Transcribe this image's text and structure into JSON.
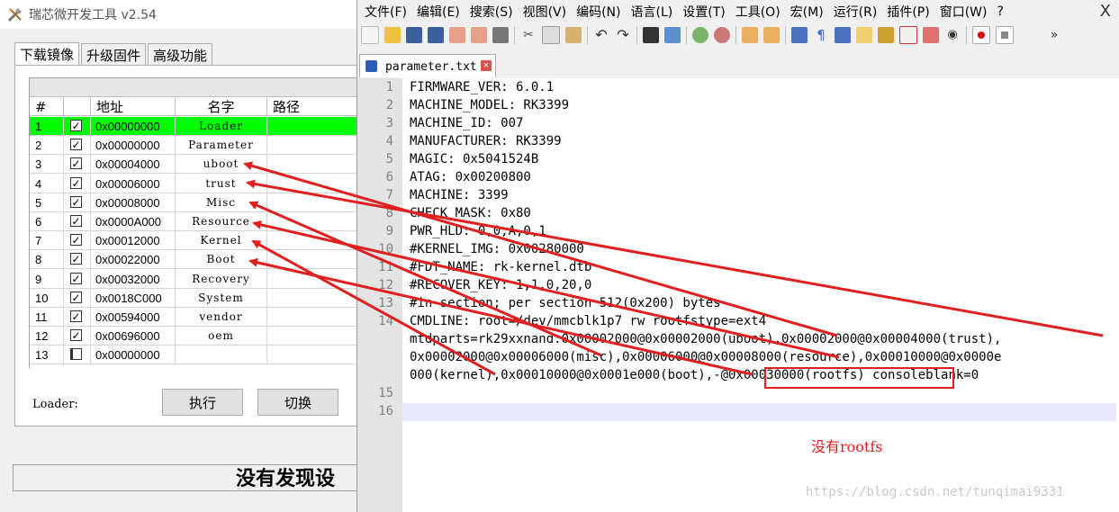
{
  "tool": {
    "title": "瑞芯微开发工具 v2.54",
    "tabs": [
      "下载镜像",
      "升级固件",
      "高级功能"
    ],
    "columns": {
      "num": "#",
      "addr": "地址",
      "name": "名字",
      "path": "路径"
    },
    "rows": [
      {
        "num": "1",
        "checked": true,
        "addr": "0x00000000",
        "name": "Loader"
      },
      {
        "num": "2",
        "checked": true,
        "addr": "0x00000000",
        "name": "Parameter"
      },
      {
        "num": "3",
        "checked": true,
        "addr": "0x00004000",
        "name": "uboot"
      },
      {
        "num": "4",
        "checked": true,
        "addr": "0x00006000",
        "name": "trust"
      },
      {
        "num": "5",
        "checked": true,
        "addr": "0x00008000",
        "name": "Misc"
      },
      {
        "num": "6",
        "checked": true,
        "addr": "0x0000A000",
        "name": "Resource"
      },
      {
        "num": "7",
        "checked": true,
        "addr": "0x00012000",
        "name": "Kernel"
      },
      {
        "num": "8",
        "checked": true,
        "addr": "0x00022000",
        "name": "Boot"
      },
      {
        "num": "9",
        "checked": true,
        "addr": "0x00032000",
        "name": "Recovery"
      },
      {
        "num": "10",
        "checked": true,
        "addr": "0x0018C000",
        "name": "System"
      },
      {
        "num": "11",
        "checked": true,
        "addr": "0x00594000",
        "name": "vendor"
      },
      {
        "num": "12",
        "checked": true,
        "addr": "0x00696000",
        "name": "oem"
      },
      {
        "num": "13",
        "checked": false,
        "addr": "0x00000000",
        "name": ""
      }
    ],
    "loader_label": "Loader:",
    "execute_button": "执行",
    "switch_button": "切换",
    "status_text": "没有发现设"
  },
  "npp": {
    "menu": [
      "文件(F)",
      "编辑(E)",
      "搜索(S)",
      "视图(V)",
      "编码(N)",
      "语言(L)",
      "设置(T)",
      "工具(O)",
      "宏(M)",
      "运行(R)",
      "插件(P)",
      "窗口(W)",
      "?"
    ],
    "close_glyph": "X",
    "file_tab": "parameter.txt",
    "lines": [
      {
        "n": "1",
        "text": "FIRMWARE_VER: 6.0.1"
      },
      {
        "n": "2",
        "text": "MACHINE_MODEL: RK3399"
      },
      {
        "n": "3",
        "text": "MACHINE_ID: 007"
      },
      {
        "n": "4",
        "text": "MANUFACTURER: RK3399"
      },
      {
        "n": "5",
        "text": "MAGIC: 0x5041524B"
      },
      {
        "n": "6",
        "text": "ATAG: 0x00200800"
      },
      {
        "n": "7",
        "text": "MACHINE: 3399"
      },
      {
        "n": "8",
        "text": "CHECK_MASK: 0x80"
      },
      {
        "n": "9",
        "text": "PWR_HLD: 0,0,A,0,1"
      },
      {
        "n": "10",
        "text": "#KERNEL_IMG: 0x00280000"
      },
      {
        "n": "11",
        "text": "#FDT_NAME: rk-kernel.dtb"
      },
      {
        "n": "12",
        "text": "#RECOVER_KEY: 1,1,0,20,0"
      },
      {
        "n": "13",
        "text": "#in section; per section 512(0x200) bytes"
      },
      {
        "n": "14",
        "text": "CMDLINE: root=/dev/mmcblk1p7 rw rootfstype=ext4"
      },
      {
        "n": "",
        "text": "mtdparts=rk29xxnand:0x00002000@0x00002000(uboot),0x00002000@0x00004000(trust),"
      },
      {
        "n": "",
        "text": "0x00002000@0x00006000(misc),0x00006000@0x00008000(resource),0x00010000@0x0000e"
      },
      {
        "n": "",
        "text": "000(kernel),0x00010000@0x0001e000(boot),-@0x00030000(rootfs) consoleblank=0"
      },
      {
        "n": "15",
        "text": ""
      },
      {
        "n": "16",
        "text": ""
      }
    ],
    "note": "没有rootfs",
    "watermark": "https://blog.csdn.net/tunqimai9331"
  },
  "colors": {
    "selected_row": "#00ff00",
    "annotation": "#e02020"
  }
}
